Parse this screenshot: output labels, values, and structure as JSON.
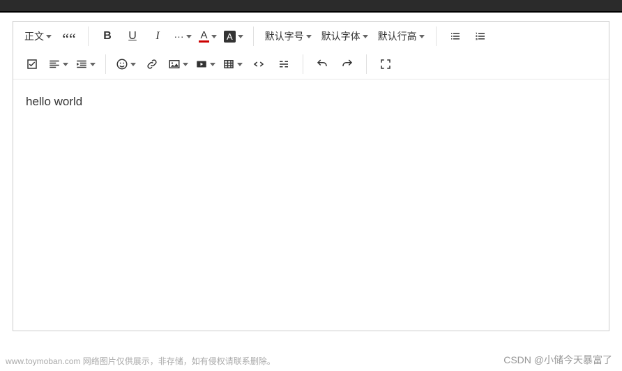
{
  "toolbar": {
    "heading_label": "正文",
    "font_size_label": "默认字号",
    "font_family_label": "默认字体",
    "line_height_label": "默认行高",
    "bold_char": "B",
    "underline_char": "U",
    "italic_char": "I",
    "more_char": "···",
    "font_color_char": "A",
    "bg_color_char": "A"
  },
  "content": {
    "text": "hello world"
  },
  "watermarks": {
    "bottom": "www.toymoban.com 网络图片仅供展示，非存储，如有侵权请联系删除。",
    "right": "CSDN @小储今天暴富了"
  }
}
